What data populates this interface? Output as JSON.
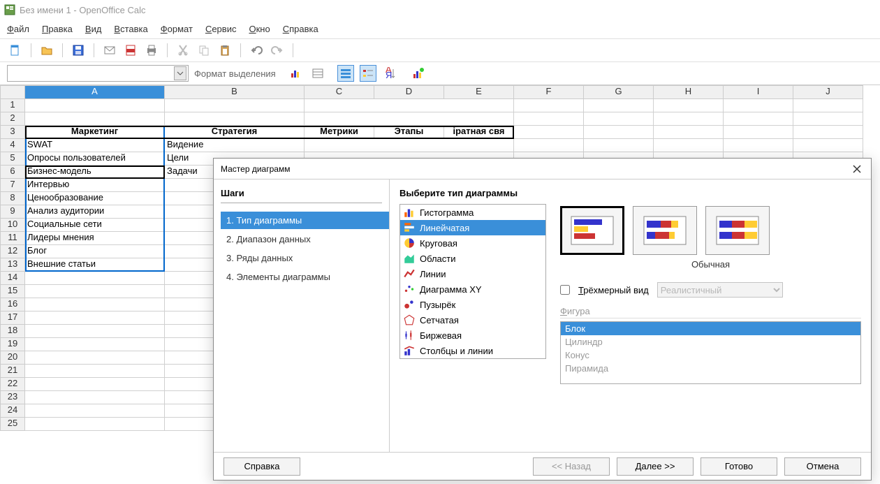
{
  "title": "Без имени 1 - OpenOffice Calc",
  "menu": [
    "Файл",
    "Правка",
    "Вид",
    "Вставка",
    "Формат",
    "Сервис",
    "Окно",
    "Справка"
  ],
  "toolbar2_label": "Формат выделения",
  "columns": [
    "A",
    "B",
    "C",
    "D",
    "E",
    "F",
    "G",
    "H",
    "I",
    "J"
  ],
  "sheet": {
    "r3": {
      "A": "Маркетинг",
      "B": "Стратегия",
      "C": "Метрики",
      "D": "Этапы",
      "E": "іратная свя"
    },
    "r4": {
      "A": "SWAT",
      "B": "Видение"
    },
    "r5": {
      "A": "Опросы пользователей",
      "B": "Цели"
    },
    "r6": {
      "A": "Бизнес-модель",
      "B": "Задачи"
    },
    "r7": {
      "A": "Интервью"
    },
    "r8": {
      "A": "Ценообразование"
    },
    "r9": {
      "A": "Анализ аудитории"
    },
    "r10": {
      "A": "Социальные сети"
    },
    "r11": {
      "A": "Лидеры мнения"
    },
    "r12": {
      "A": "Блог"
    },
    "r13": {
      "A": "Внешние статьи"
    }
  },
  "dialog": {
    "title": "Мастер диаграмм",
    "steps_title": "Шаги",
    "steps": [
      "1. Тип диаграммы",
      "2. Диапазон данных",
      "3. Ряды данных",
      "4. Элементы диаграммы"
    ],
    "select_type_label": "Выберите тип диаграммы",
    "chart_types": [
      "Гистограмма",
      "Линейчатая",
      "Круговая",
      "Области",
      "Линии",
      "Диаграмма XY",
      "Пузырёк",
      "Сетчатая",
      "Биржевая",
      "Столбцы и линии"
    ],
    "subtype_label": "Обычная",
    "threed_label": "Трёхмерный вид",
    "threed_style": "Реалистичный",
    "shape_label": "Фигура",
    "shapes": [
      "Блок",
      "Цилиндр",
      "Конус",
      "Пирамида"
    ],
    "btn_help": "Справка",
    "btn_back": "<< Назад",
    "btn_next": "Далее >>",
    "btn_finish": "Готово",
    "btn_cancel": "Отмена"
  }
}
